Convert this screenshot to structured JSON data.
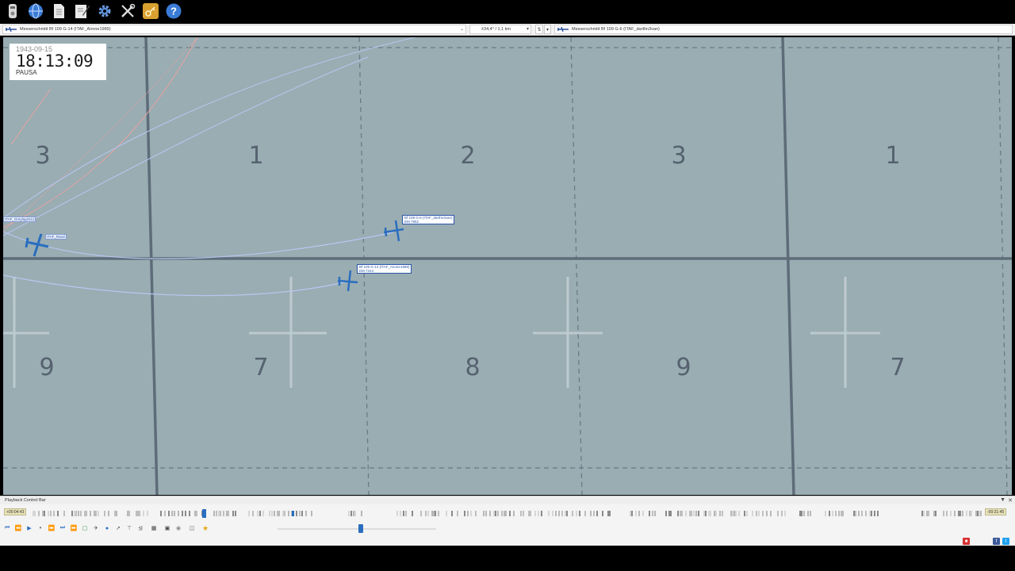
{
  "toolbar": {
    "items": [
      {
        "name": "flight-recorder-icon",
        "color": "#d8d8d8"
      },
      {
        "name": "globe-icon",
        "color": "#3a7bd5"
      },
      {
        "name": "document-icon",
        "color": "#e0e0e0"
      },
      {
        "name": "edit-notes-icon",
        "color": "#e0e0e0"
      },
      {
        "name": "gear-icon",
        "color": "#5a8fd8"
      },
      {
        "name": "tools-icon",
        "color": "#e0e0e0"
      },
      {
        "name": "key-icon",
        "color": "#d9a030"
      },
      {
        "name": "help-icon",
        "color": "#3a7bd5"
      }
    ]
  },
  "selection": {
    "primary_aircraft": "Messerschmitt Bf 109 G-14 (ITAF_Airone1989)",
    "range_info": "±34,4° / 1,1 km",
    "secondary_aircraft": "Messerschmitt Bf 109 G-6 (ITAF_darthn3van)"
  },
  "clock": {
    "date": "1943-09-15",
    "time": "18:13:09",
    "status": "PAUSA"
  },
  "map": {
    "grid_numbers": [
      "3",
      "1",
      "2",
      "3",
      "1",
      "9",
      "7",
      "8",
      "9",
      "7"
    ],
    "aircraft_labels": {
      "a1_line1": "Bf 109 G-6 (ITAF_darthn3van)",
      "a1_line2": "EM 7952",
      "a2_line1": "Bf 109 G-14 (ITAF_Airone1989)",
      "a2_line2": "EM 7314",
      "a3_name": "ITAF_Rand",
      "a4_name": "ITAF_Greylag1511"
    },
    "colors": {
      "background": "#99adb3",
      "grid_line": "#5e6c79",
      "aircraft": "#2a6ebf",
      "track": "#b9c6f0",
      "track_red": "#e8a3a0"
    }
  },
  "playback": {
    "title": "Playback Control Bar",
    "time_elapsed": "+00:04:43",
    "time_remaining": "-00:21:45",
    "progress": 0.2
  }
}
